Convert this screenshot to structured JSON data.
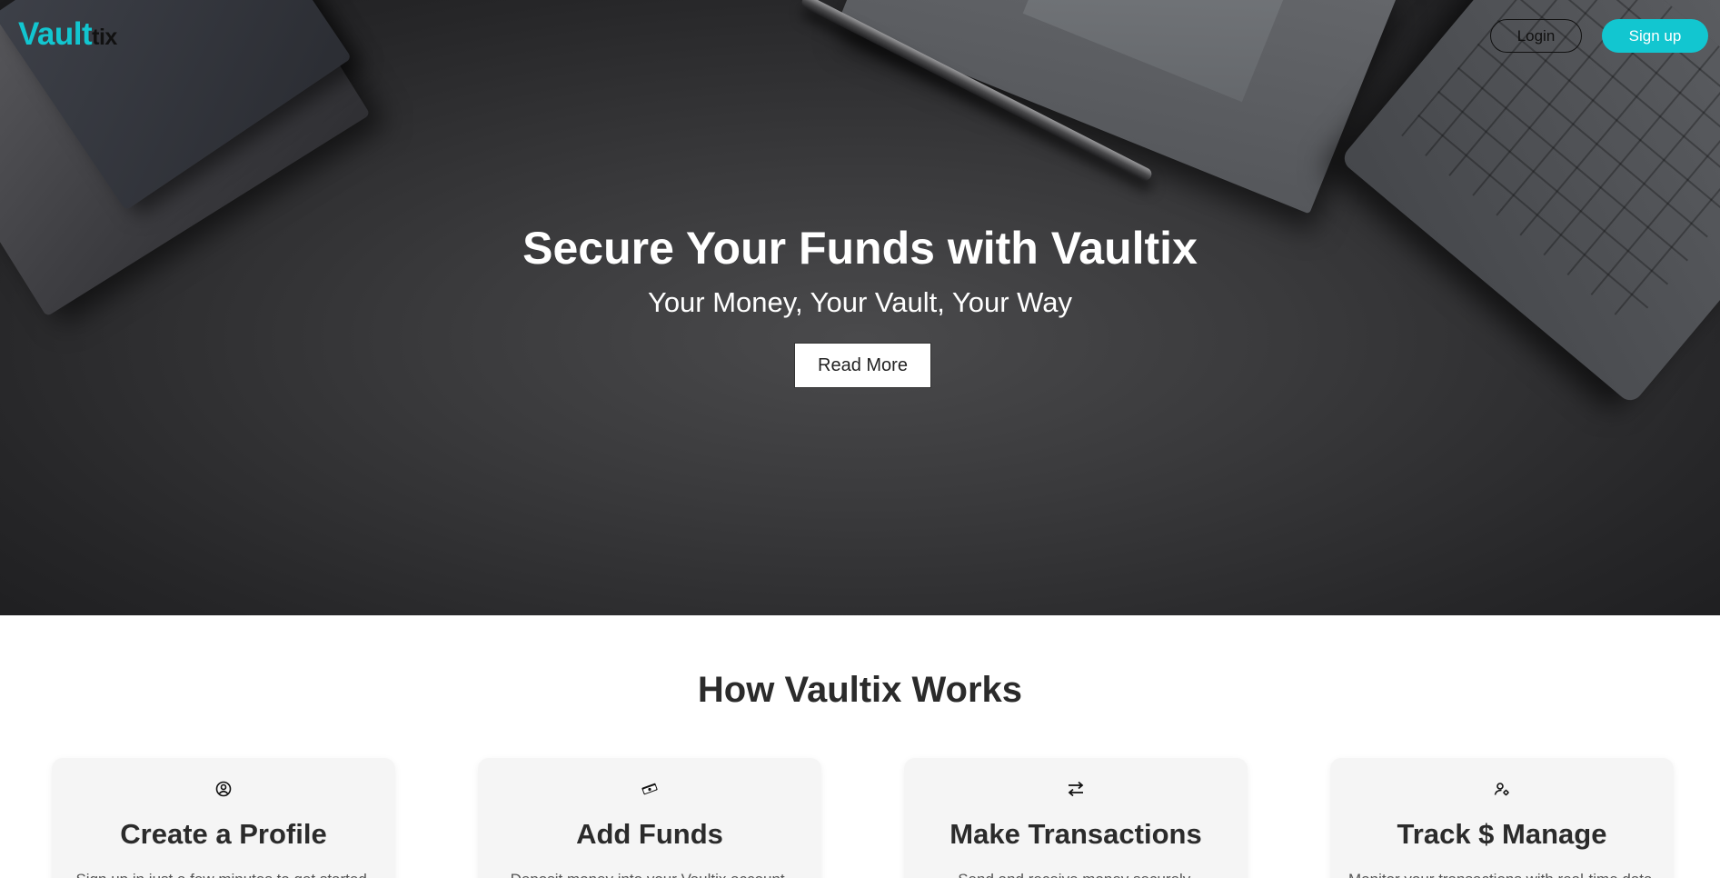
{
  "brand": {
    "part1": "Vault",
    "part2": "tix",
    "accent": "#12c6d0"
  },
  "nav": {
    "login_label": "Login",
    "signup_label": "Sign up"
  },
  "hero": {
    "title": "Secure Your Funds with Vaultix",
    "subtitle": "Your Money, Your Vault, Your Way",
    "cta_label": "Read More"
  },
  "how": {
    "title": "How Vaultix Works",
    "cards": [
      {
        "icon": "user-circle-icon",
        "title": "Create a Profile",
        "text": "Sign up in just a few minutes to get started."
      },
      {
        "icon": "money-icon",
        "title": "Add Funds",
        "text": "Deposit money into your Vaultix account."
      },
      {
        "icon": "transfer-arrows-icon",
        "title": "Make Transactions",
        "text": "Send and receive money securely."
      },
      {
        "icon": "user-settings-icon",
        "title": "Track $ Manage",
        "text": "Monitor your transactions with real-time data."
      }
    ]
  }
}
